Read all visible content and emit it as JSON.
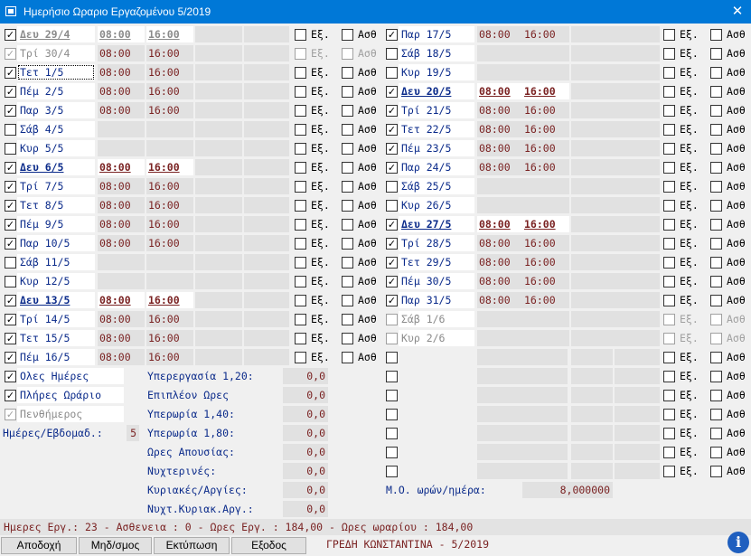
{
  "window": {
    "title": "Ημερήσιο Ωραριο Εργαζομένου 5/2019"
  },
  "labels": {
    "ex": "Εξ.",
    "asth": "Ασθ"
  },
  "left_days": [
    {
      "day": "Δευ 29/4",
      "in": "08:00",
      "out": "16:00",
      "checked": true,
      "state": "wkd"
    },
    {
      "day": "Τρί 30/4",
      "in": "08:00",
      "out": "16:00",
      "checked": true,
      "state": "dis"
    },
    {
      "day": "Τετ 1/5",
      "in": "08:00",
      "out": "16:00",
      "checked": true,
      "state": "focus"
    },
    {
      "day": "Πέμ 2/5",
      "in": "08:00",
      "out": "16:00",
      "checked": true,
      "state": ""
    },
    {
      "day": "Παρ 3/5",
      "in": "08:00",
      "out": "16:00",
      "checked": true,
      "state": ""
    },
    {
      "day": "Σάβ 4/5",
      "in": "",
      "out": "",
      "checked": false,
      "state": ""
    },
    {
      "day": "Κυρ 5/5",
      "in": "",
      "out": "",
      "checked": false,
      "state": ""
    },
    {
      "day": "Δευ 6/5",
      "in": "08:00",
      "out": "16:00",
      "checked": true,
      "state": "wk"
    },
    {
      "day": "Τρί 7/5",
      "in": "08:00",
      "out": "16:00",
      "checked": true,
      "state": ""
    },
    {
      "day": "Τετ 8/5",
      "in": "08:00",
      "out": "16:00",
      "checked": true,
      "state": ""
    },
    {
      "day": "Πέμ 9/5",
      "in": "08:00",
      "out": "16:00",
      "checked": true,
      "state": ""
    },
    {
      "day": "Παρ 10/5",
      "in": "08:00",
      "out": "16:00",
      "checked": true,
      "state": ""
    },
    {
      "day": "Σάβ 11/5",
      "in": "",
      "out": "",
      "checked": false,
      "state": ""
    },
    {
      "day": "Κυρ 12/5",
      "in": "",
      "out": "",
      "checked": false,
      "state": ""
    },
    {
      "day": "Δευ 13/5",
      "in": "08:00",
      "out": "16:00",
      "checked": true,
      "state": "wk"
    },
    {
      "day": "Τρί 14/5",
      "in": "08:00",
      "out": "16:00",
      "checked": true,
      "state": ""
    },
    {
      "day": "Τετ 15/5",
      "in": "08:00",
      "out": "16:00",
      "checked": true,
      "state": ""
    },
    {
      "day": "Πέμ 16/5",
      "in": "08:00",
      "out": "16:00",
      "checked": true,
      "state": ""
    }
  ],
  "right_days": [
    {
      "day": "Παρ 17/5",
      "in": "08:00",
      "out": "16:00",
      "checked": true,
      "state": ""
    },
    {
      "day": "Σάβ 18/5",
      "in": "",
      "out": "",
      "checked": false,
      "state": ""
    },
    {
      "day": "Κυρ 19/5",
      "in": "",
      "out": "",
      "checked": false,
      "state": ""
    },
    {
      "day": "Δευ 20/5",
      "in": "08:00",
      "out": "16:00",
      "checked": true,
      "state": "wk"
    },
    {
      "day": "Τρί 21/5",
      "in": "08:00",
      "out": "16:00",
      "checked": true,
      "state": ""
    },
    {
      "day": "Τετ 22/5",
      "in": "08:00",
      "out": "16:00",
      "checked": true,
      "state": ""
    },
    {
      "day": "Πέμ 23/5",
      "in": "08:00",
      "out": "16:00",
      "checked": true,
      "state": ""
    },
    {
      "day": "Παρ 24/5",
      "in": "08:00",
      "out": "16:00",
      "checked": true,
      "state": ""
    },
    {
      "day": "Σάβ 25/5",
      "in": "",
      "out": "",
      "checked": false,
      "state": ""
    },
    {
      "day": "Κυρ 26/5",
      "in": "",
      "out": "",
      "checked": false,
      "state": ""
    },
    {
      "day": "Δευ 27/5",
      "in": "08:00",
      "out": "16:00",
      "checked": true,
      "state": "wk"
    },
    {
      "day": "Τρί 28/5",
      "in": "08:00",
      "out": "16:00",
      "checked": true,
      "state": ""
    },
    {
      "day": "Τετ 29/5",
      "in": "08:00",
      "out": "16:00",
      "checked": true,
      "state": ""
    },
    {
      "day": "Πέμ 30/5",
      "in": "08:00",
      "out": "16:00",
      "checked": true,
      "state": ""
    },
    {
      "day": "Παρ 31/5",
      "in": "08:00",
      "out": "16:00",
      "checked": true,
      "state": ""
    },
    {
      "day": "Σάβ 1/6",
      "in": "",
      "out": "",
      "checked": false,
      "state": "dis"
    },
    {
      "day": "Κυρ 2/6",
      "in": "",
      "out": "",
      "checked": false,
      "state": "dis"
    }
  ],
  "right_blank_rows": 7,
  "options": [
    {
      "label": "Ολες Ημέρες",
      "checked": true,
      "disabled": false
    },
    {
      "label": "Πλήρες Ωράριο",
      "checked": true,
      "disabled": false
    },
    {
      "label": "Πενθήμερος",
      "checked": true,
      "disabled": true
    }
  ],
  "days_per_week": {
    "label": "Ημέρες/Εβδομαδ.:",
    "value": "5"
  },
  "stats": [
    {
      "label": "Υπερεργασία 1,20:",
      "value": "0,0"
    },
    {
      "label": "Επιπλέον Ωρες",
      "value": "0,0"
    },
    {
      "label": "Υπερωρία 1,40:",
      "value": "0,0"
    },
    {
      "label": "Υπερωρία 1,80:",
      "value": "0,0"
    },
    {
      "label": "Ωρες Απουσίας:",
      "value": "0,0"
    },
    {
      "label": "Νυχτερινές:",
      "value": "0,0"
    },
    {
      "label": "Κυριακές/Αργίες:",
      "value": "0,0"
    },
    {
      "label": "Νυχτ.Κυριακ.Αργ.:",
      "value": "0,0"
    }
  ],
  "avg_hours": {
    "label": "Μ.Ο. ωρών/ημέρα:",
    "value": "8,000000"
  },
  "status": "Ημερες Εργ.: 23 - Ασθενεια : 0 - Ωρες Εργ. : 184,00 - Ωρες ωραρίου : 184,00",
  "buttons": {
    "accept": "Αποδοχή",
    "zero": "Μηδ/σμος",
    "print": "Εκτύπωση",
    "exit": "Εξοδος"
  },
  "employee": "ΓΡΕΔΗ ΚΩΝΣΤΑΝΤΙΝΑ - 5/2019",
  "icons": {
    "app": "app-window-icon",
    "close": "close-icon",
    "info": "info-icon"
  }
}
